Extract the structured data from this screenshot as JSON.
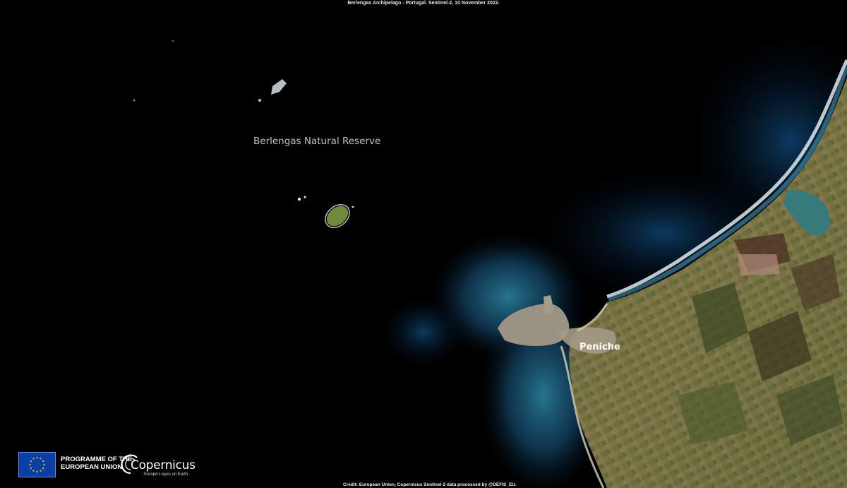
{
  "caption": "Berlengas Archipelago - Portugal. Sentinel-2, 10 November 2022.",
  "labels": {
    "reserve": "Berlengas Natural Reserve",
    "town": "Peniche"
  },
  "footer": {
    "eu_line1": "PROGRAMME OF THE",
    "eu_line2": "EUROPEAN UNION",
    "copernicus": "Copernicus",
    "copernicus_tagline": "Europe's eyes on Earth",
    "credit": "Credit: European Union, Copernicus  Sentinel-2 data processed by @DEFIS_EU."
  },
  "colors": {
    "ocean": "#000000",
    "coastal_water": "#2f6f8c",
    "land": "#7a7442",
    "surf": "#e8f0f4",
    "eu_blue": "#0a3fa8",
    "eu_star": "#ffd200"
  },
  "icons": [
    "eu-flag-icon",
    "copernicus-logo-icon"
  ]
}
